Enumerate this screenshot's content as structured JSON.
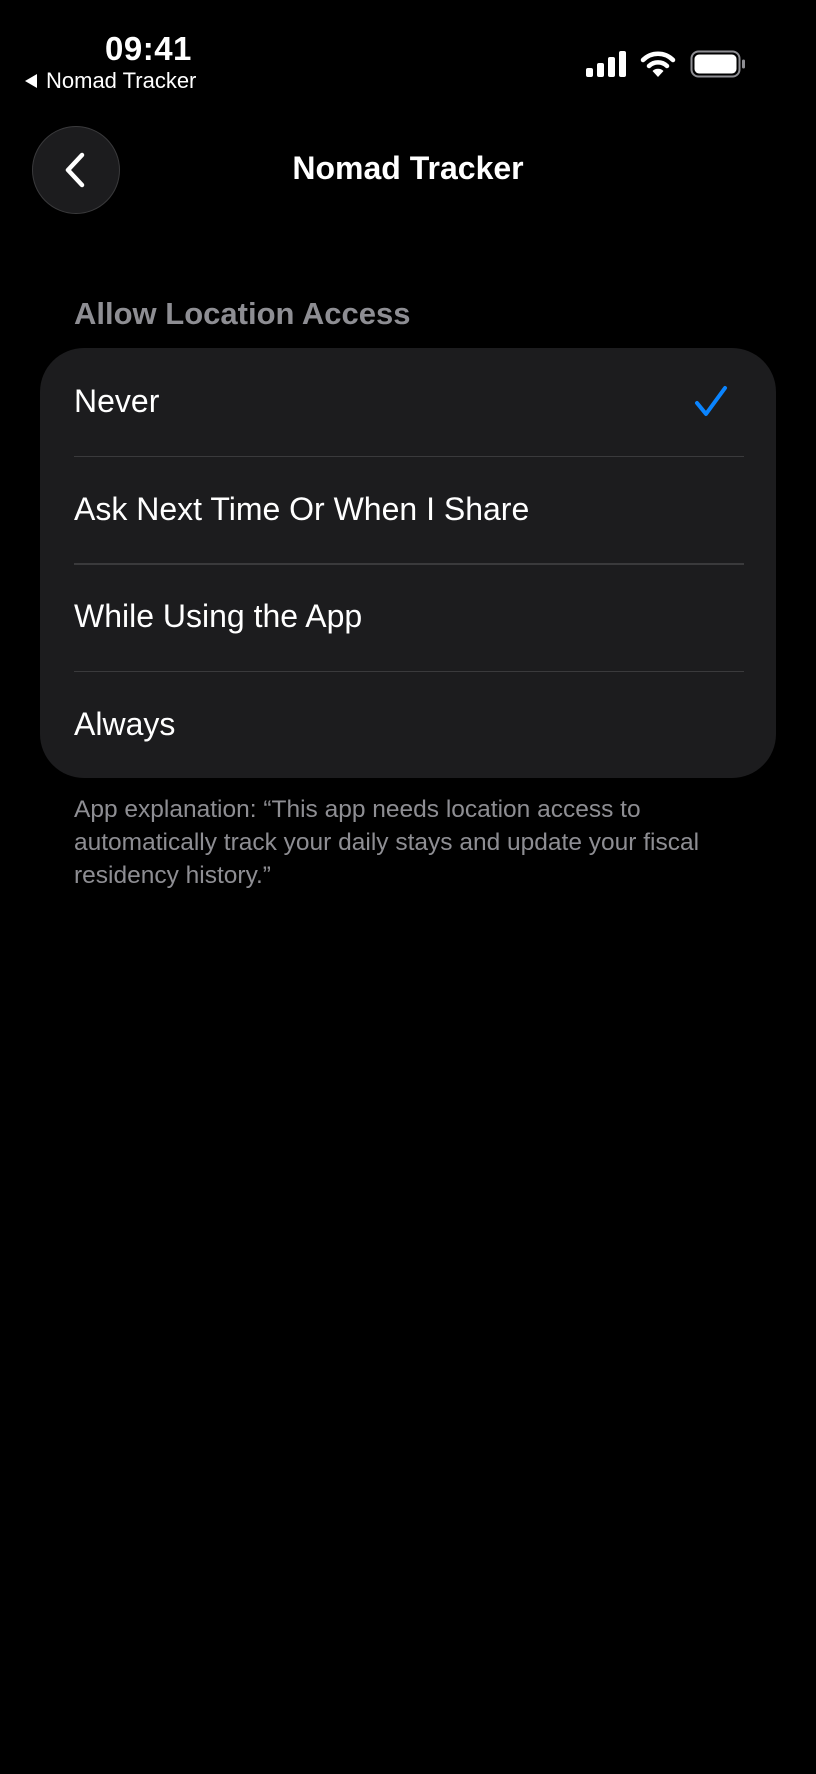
{
  "status_bar": {
    "time": "09:41",
    "back_app": "Nomad Tracker",
    "signal_icon": "cellular-signal-icon",
    "wifi_icon": "wifi-icon",
    "battery_icon": "battery-icon"
  },
  "nav": {
    "title": "Nomad Tracker",
    "back_icon": "chevron-left-icon"
  },
  "section": {
    "header": "Allow Location Access",
    "options": [
      {
        "label": "Never",
        "selected": true
      },
      {
        "label": "Ask Next Time Or When I Share",
        "selected": false
      },
      {
        "label": "While Using the App",
        "selected": false
      },
      {
        "label": "Always",
        "selected": false
      }
    ],
    "footer": "App explanation: “This app needs location access to automatically track your daily stays and update your fiscal residency history.”"
  },
  "colors": {
    "background": "#000000",
    "card": "#1c1c1e",
    "separator": "#3a3a3c",
    "secondary_text": "#8e8e93",
    "accent": "#0a84ff"
  }
}
